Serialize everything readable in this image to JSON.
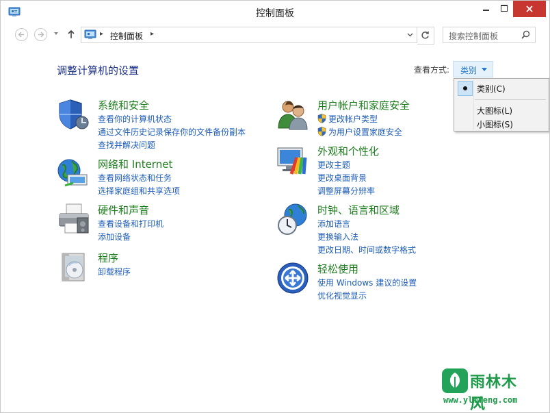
{
  "window": {
    "title": "控制面板"
  },
  "nav": {
    "breadcrumb": "控制面板",
    "breadcrumb_sep": "▸",
    "search_placeholder": "搜索控制面板"
  },
  "main": {
    "page_title": "调整计算机的设置",
    "view_by_label": "查看方式:",
    "view_by_value": "类别"
  },
  "view_menu": {
    "items": [
      {
        "label": "类别(C)",
        "selected": true
      },
      {
        "label": "大图标(L)",
        "selected": false
      },
      {
        "label": "小图标(S)",
        "selected": false
      }
    ]
  },
  "categories": [
    {
      "title": "系统和安全",
      "icon": "shield-icon",
      "links": [
        "查看你的计算机状态",
        "通过文件历史记录保存你的文件备份副本",
        "查找并解决问题"
      ]
    },
    {
      "title": "网络和 Internet",
      "icon": "network-globe-icon",
      "links": [
        "查看网络状态和任务",
        "选择家庭组和共享选项"
      ]
    },
    {
      "title": "硬件和声音",
      "icon": "printer-icon",
      "links": [
        "查看设备和打印机",
        "添加设备"
      ]
    },
    {
      "title": "程序",
      "icon": "programs-disc-icon",
      "links": [
        "卸载程序"
      ]
    },
    {
      "title": "用户帐户和家庭安全",
      "icon": "users-icon",
      "links": [
        "更改帐户类型",
        "为用户设置家庭安全"
      ]
    },
    {
      "title": "外观和个性化",
      "icon": "monitor-palette-icon",
      "links": [
        "更改主题",
        "更改桌面背景",
        "调整屏幕分辨率"
      ]
    },
    {
      "title": "时钟、语言和区域",
      "icon": "clock-globe-icon",
      "links": [
        "添加语言",
        "更换输入法",
        "更改日期、时间或数字格式"
      ]
    },
    {
      "title": "轻松使用",
      "icon": "ease-of-access-icon",
      "links": [
        "使用 Windows 建议的设置",
        "优化视觉显示"
      ]
    }
  ],
  "watermark": {
    "name": "雨林木风",
    "url": "www.ylmfeng.com"
  },
  "colors": {
    "category_title": "#1e7d1e",
    "link": "#1e5db8",
    "page_title": "#1e3287",
    "close_button": "#c7372f"
  }
}
